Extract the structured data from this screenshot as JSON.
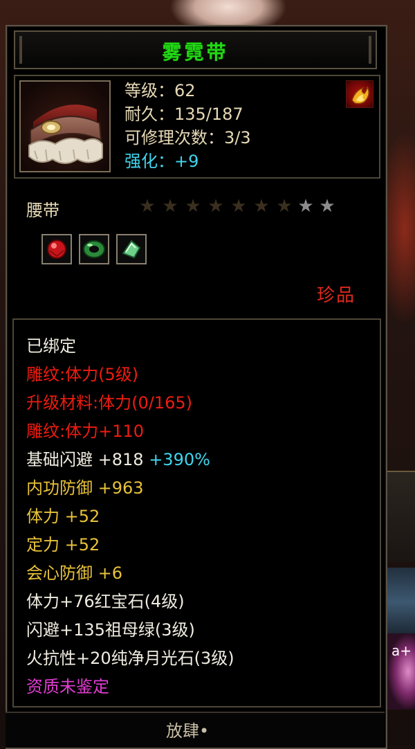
{
  "item": {
    "name": "雾霓带",
    "name_color": "#22d814",
    "icon": "fur-belt-icon",
    "badge_icon": "flame-badge-icon"
  },
  "stats": {
    "level": "等级：62",
    "durability": "耐久：135/187",
    "repair": "可修理次数：3/3",
    "enhance": "强化：+9"
  },
  "type": "腰带",
  "stars": {
    "total": 9,
    "lit": 2
  },
  "gems": [
    "ruby-gem-icon",
    "emerald-ring-gem-icon",
    "moonstone-gem-icon"
  ],
  "quality": "珍品",
  "attributes": {
    "bound": "已绑定",
    "engrave": "雕纹:体力(5级)",
    "upgrade_material": "升级材料:体力(0/165)",
    "engrave_bonus": "雕纹:体力+110",
    "dodge_label": "基础闪避 +818",
    "dodge_pct": "+390%",
    "inner_def": "内功防御 +963",
    "stamina": "体力 +52",
    "focus": "定力 +52",
    "crit_def": "会心防御 +6",
    "gem1": "体力+76红宝石(4级)",
    "gem2": "闪避+135祖母绿(3级)",
    "gem3": "火抗性+20纯净月光石(3级)",
    "aptitude": "资质未鉴定"
  },
  "footer": "放肆•",
  "background": {
    "side_label": "a+"
  },
  "colors": {
    "stat_text": "#e6d9b6",
    "enhance": "#3fd6ee",
    "bound_text": "#f0ece0",
    "engrave_red": "#ee1c10",
    "base_attr": "#e8c23a",
    "aptitude": "#e23cd2",
    "quality_red": "#e02a1c"
  }
}
